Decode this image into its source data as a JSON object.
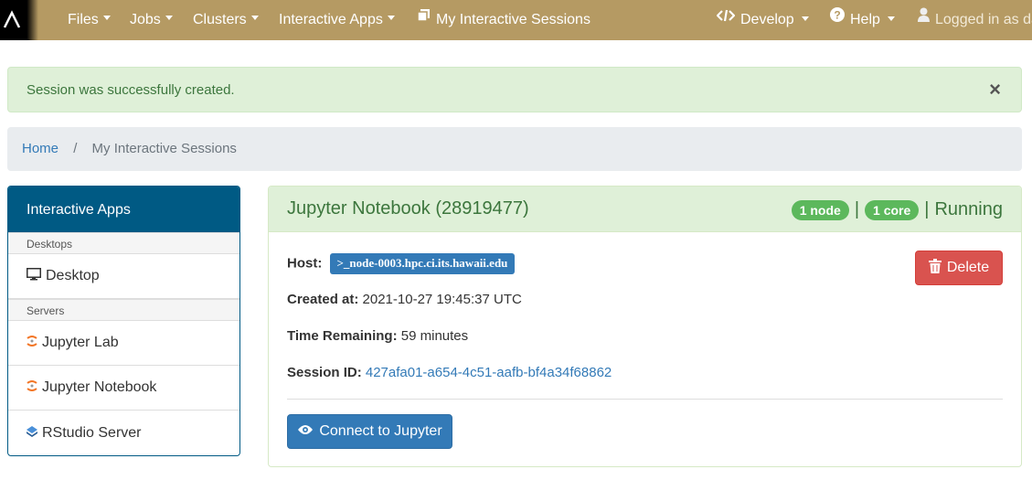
{
  "navbar": {
    "items": [
      {
        "label": "Files",
        "icon": "caret-down"
      },
      {
        "label": "Jobs",
        "icon": "caret-down"
      },
      {
        "label": "Clusters",
        "icon": "caret-down"
      },
      {
        "label": "Interactive Apps",
        "icon": "caret-down"
      },
      {
        "label": "My Interactive Sessions",
        "icon": "copy-icon"
      }
    ],
    "right": {
      "develop": "Develop",
      "help": "Help",
      "user": "Logged in as da"
    },
    "colors": {
      "background": "#b59a63",
      "text": "#ffffff"
    }
  },
  "alert": {
    "message": "Session was successfully created.",
    "close": "×"
  },
  "breadcrumb": {
    "home": "Home",
    "separator": "/",
    "current": "My Interactive Sessions"
  },
  "sidebar": {
    "title": "Interactive Apps",
    "categories": [
      {
        "label": "Desktops",
        "items": [
          {
            "label": "Desktop",
            "icon": "monitor-icon"
          }
        ]
      },
      {
        "label": "Servers",
        "items": [
          {
            "label": "Jupyter Lab",
            "icon": "jupyter-icon"
          },
          {
            "label": "Jupyter Notebook",
            "icon": "jupyter-icon"
          },
          {
            "label": "RStudio Server",
            "icon": "rstudio-icon"
          }
        ]
      }
    ],
    "color": "#005a84"
  },
  "session": {
    "title": "Jupyter Notebook (28919477)",
    "nodes": "1 node",
    "cores": "1 core",
    "divider": "|",
    "status": "Running",
    "host_label": "Host:",
    "host_value": ">_node-0003.hpc.ci.its.hawaii.edu",
    "created_label": "Created at:",
    "created_value": "2021-10-27 19:45:37 UTC",
    "remaining_label": "Time Remaining:",
    "remaining_value": "59 minutes",
    "session_id_label": "Session ID:",
    "session_id_value": "427afa01-a654-4c51-aafb-bf4a34f68862",
    "delete_label": "Delete",
    "connect_label": "Connect to Jupyter"
  }
}
